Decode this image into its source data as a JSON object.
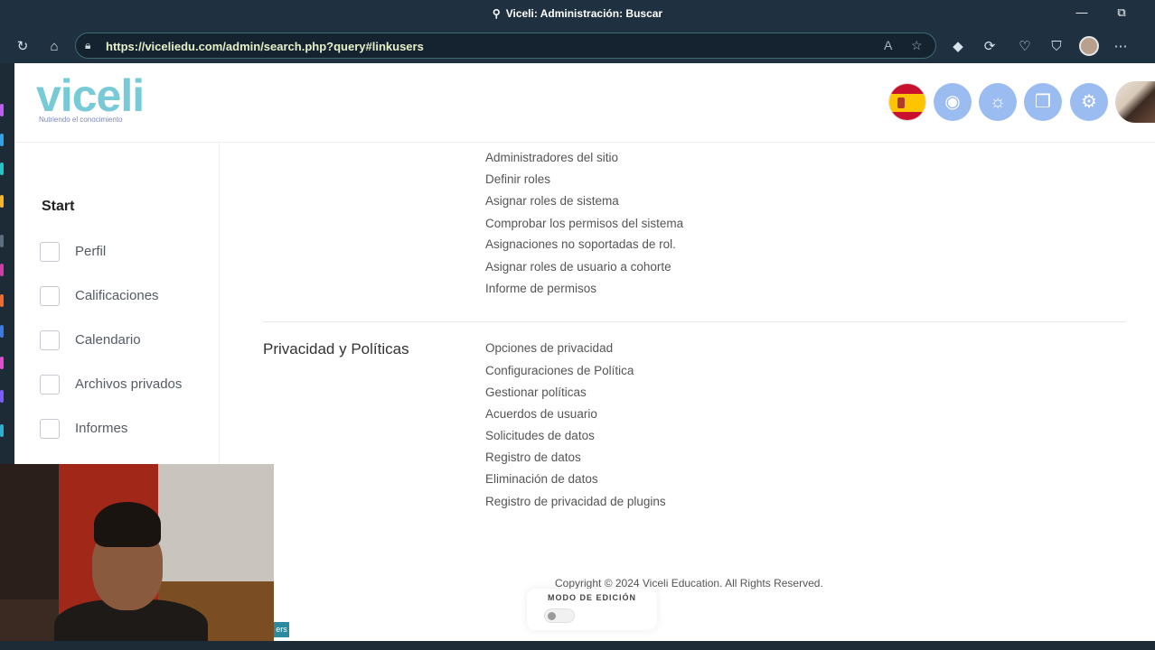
{
  "browser": {
    "window_title": "Viceli: Administración: Buscar",
    "url": "https://viceliedu.com/admin/search.php?query#linkusers",
    "icons": [
      "refresh-icon",
      "home-icon",
      "lock-icon",
      "read-aloud-icon",
      "favorite-icon",
      "extension-icon",
      "copilot-icon",
      "health-icon",
      "shield-icon",
      "profile-avatar",
      "more-icon"
    ]
  },
  "header": {
    "logo": "viceli",
    "tagline": "Nutriendo el conocimiento",
    "icons": [
      "spain-flag-icon",
      "hide-icon",
      "robot-icon",
      "chat-icon",
      "gear-icon",
      "user-avatar"
    ],
    "accent_color": "#9bbcf0"
  },
  "sidebar": {
    "heading": "Start",
    "items": [
      {
        "label": "Perfil",
        "icon": "profile-icon"
      },
      {
        "label": "Calificaciones",
        "icon": "grades-icon"
      },
      {
        "label": "Calendario",
        "icon": "calendar-icon"
      },
      {
        "label": "Archivos privados",
        "icon": "file-icon"
      },
      {
        "label": "Informes",
        "icon": "reports-icon"
      }
    ]
  },
  "main": {
    "roles_links": [
      "Administradores del sitio",
      "Definir roles",
      "Asignar roles de sistema",
      "Comprobar los permisos del sistema",
      "Asignaciones no soportadas de rol.",
      "Asignar roles de usuario a cohorte",
      "Informe de permisos"
    ],
    "privacy_section": {
      "title": "Privacidad y Políticas",
      "links": [
        "Opciones de privacidad",
        "Configuraciones de Política",
        "Gestionar políticas",
        "Acuerdos de usuario",
        "Solicitudes de datos",
        "Registro de datos",
        "Eliminación de datos",
        "Registro de privacidad de plugins"
      ]
    },
    "footer": "Copyright © 2024 Viceli Education. All Rights Reserved."
  },
  "edit_mode": {
    "label": "MODO DE EDICIÓN",
    "enabled": false
  },
  "tab_chip": "ers"
}
